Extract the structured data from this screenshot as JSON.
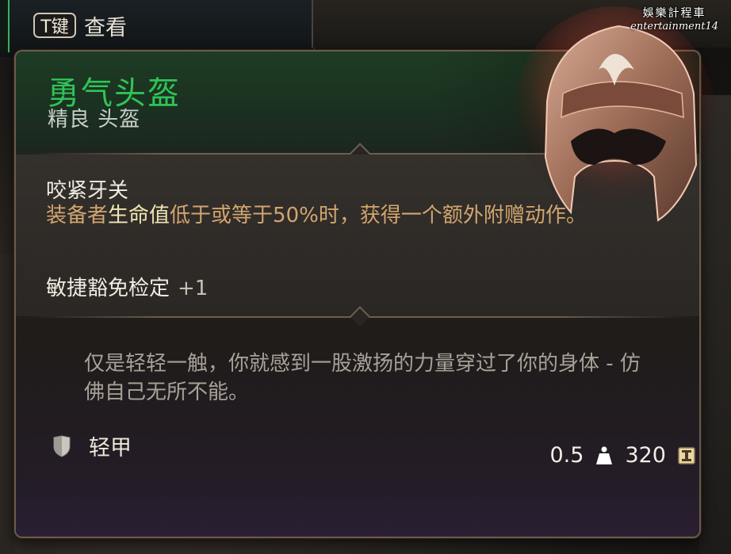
{
  "hint": {
    "key": "T键",
    "label": "查看"
  },
  "watermark": {
    "line1": "娛樂計程車",
    "line2": "entertainment14"
  },
  "item": {
    "name": "勇气头盔",
    "subtitle": "精良 头盔",
    "passive_title": "咬紧牙关",
    "passive_desc_before": "装备者",
    "passive_desc_highlight": "生命值",
    "passive_desc_after": "低于或等于50%时，获得一个额外附赠动作。",
    "stat_name": "敏捷豁免检定",
    "stat_bonus": "+1",
    "flavor": "仅是轻轻一触，你就感到一股激扬的力量穿过了你的身体 - 仿佛自己无所不能。",
    "armor_type": "轻甲",
    "armor_icon": "shield-icon",
    "weight": "0.5",
    "weight_icon": "weight-icon",
    "value": "320",
    "value_icon": "gold-coin-icon"
  },
  "colors": {
    "name": "#2fc456",
    "desc": "#d2a56f",
    "highlight": "#f2e6b4",
    "header_bg": "#1d3c24"
  }
}
